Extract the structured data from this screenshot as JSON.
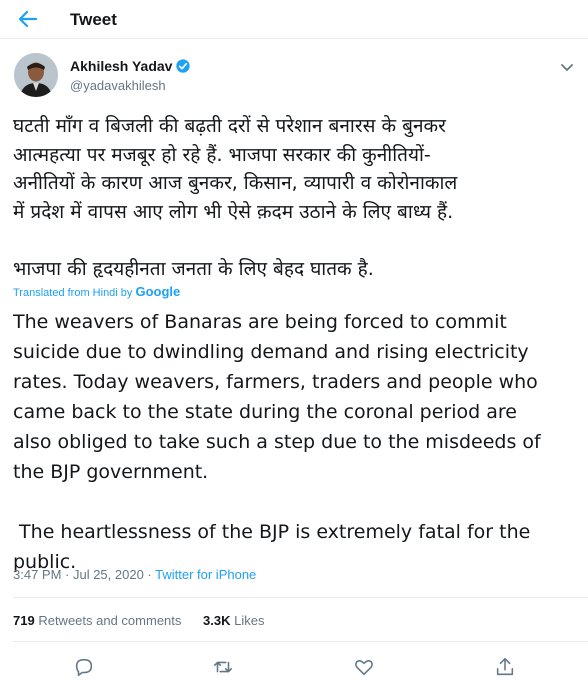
{
  "header": {
    "title": "Tweet",
    "back_icon": "back-arrow-icon"
  },
  "author": {
    "display_name": "Akhilesh Yadav",
    "handle": "@yadavakhilesh",
    "verified": true
  },
  "tweet": {
    "text": "घटती माँग व बिजली की बढ़ती दरों से परेशान बनारस के बुनकर\nआत्महत्या पर मजबूर हो रहे हैं. भाजपा सरकार की कुनीतियों-\nअनीतियों के कारण आज बुनकर, किसान, व्यापारी व कोरोनाकाल\nमें प्रदेश में वापस आए लोग भी ऐसे क़दम उठाने के लिए बाध्य हैं.\n\nभाजपा की हृदयहीनता जनता के लिए बेहद घातक है.",
    "translated_from": "Translated from Hindi by",
    "translator": "Google",
    "translation": "The weavers of Banaras are being forced to commit\nsuicide due to dwindling demand and rising electricity\nrates. Today weavers, farmers, traders and people who\ncame back to the state during the coronal period are\nalso obliged to take such a step due to the misdeeds of\nthe BJP government.\n\n The heartlessness of the BJP is extremely fatal for the\npublic.",
    "time": "3:47 PM · Jul 25, 2020 · ",
    "source": "Twitter for iPhone"
  },
  "stats": {
    "retweets_count": "719",
    "retweets_label": "Retweets and comments",
    "likes_count": "3.3K",
    "likes_label": "Likes"
  },
  "actions": [
    "reply-icon",
    "retweet-icon",
    "like-icon",
    "share-icon"
  ],
  "colors": {
    "accent": "#1da1f2",
    "muted": "#657786",
    "text": "#14171a",
    "border": "#e6ecf0"
  }
}
